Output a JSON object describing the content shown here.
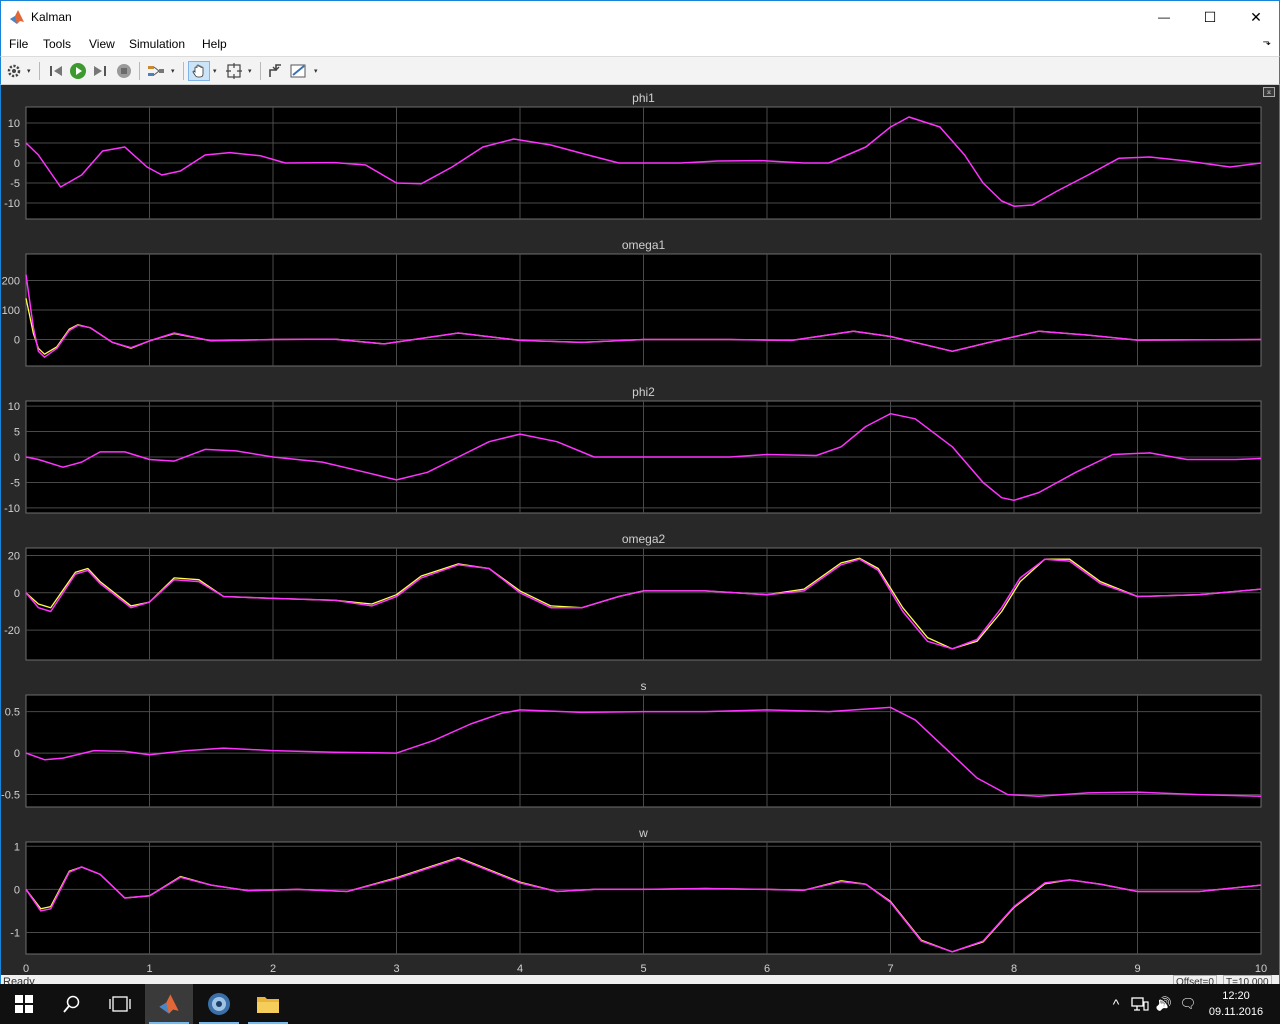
{
  "window": {
    "title": "Kalman",
    "minimize_glyph": "—",
    "maximize_glyph": "☐",
    "close_glyph": "✕"
  },
  "menu": {
    "items": [
      "File",
      "Tools",
      "View",
      "Simulation",
      "Help"
    ],
    "overflow_glyph": "⬎"
  },
  "toolbar": {
    "icons": [
      "settings-icon",
      "step-back-icon",
      "run-icon",
      "step-forward-icon",
      "stop-icon",
      "highlight-icon",
      "pan-icon",
      "zoom-fit-icon",
      "restore-icon",
      "measure-icon"
    ],
    "dropdown_glyph": "▾"
  },
  "scope": {
    "undock_glyph": "⌅",
    "colors": {
      "background": "#282828",
      "axes_bg": "#000000",
      "grid": "#4a4a4a",
      "frame": "#6e6e6e",
      "text": "#d0d0d0",
      "signal_a": "#ffff4d",
      "signal_b": "#ff33ff"
    },
    "x_ticks": [
      "0",
      "1",
      "2",
      "3",
      "4",
      "5",
      "6",
      "7",
      "8",
      "9",
      "10"
    ],
    "plots": [
      {
        "title": "phi1",
        "ylim": [
          -14,
          14
        ],
        "yticks": [
          {
            "v": 10,
            "l": "10"
          },
          {
            "v": 5,
            "l": "5"
          },
          {
            "v": 0,
            "l": "0"
          },
          {
            "v": -5,
            "l": "-5"
          },
          {
            "v": -10,
            "l": "-10"
          }
        ],
        "x": [
          0,
          0.1,
          0.28,
          0.45,
          0.62,
          0.8,
          0.98,
          1.1,
          1.25,
          1.45,
          1.65,
          1.9,
          2.1,
          2.5,
          2.75,
          3.0,
          3.2,
          3.45,
          3.7,
          3.95,
          4.25,
          4.55,
          4.8,
          5.0,
          5.3,
          5.6,
          5.95,
          6.3,
          6.5,
          6.8,
          7.0,
          7.15,
          7.4,
          7.6,
          7.75,
          7.9,
          8.0,
          8.15,
          8.35,
          8.6,
          8.85,
          9.1,
          9.4,
          9.75,
          10.0
        ],
        "y": [
          5,
          2,
          -6,
          -3,
          3,
          4,
          -1,
          -3,
          -2,
          2,
          2.6,
          1.8,
          0,
          0.1,
          -0.5,
          -5,
          -5.2,
          -1,
          4,
          6,
          4.5,
          2,
          0,
          0,
          0,
          0.5,
          0.6,
          0,
          0,
          4,
          9,
          11.5,
          9,
          2,
          -5,
          -9.5,
          -10.8,
          -10.5,
          -7,
          -3,
          1.2,
          1.5,
          0.5,
          -1,
          0
        ],
        "y2": null
      },
      {
        "title": "omega1",
        "ylim": [
          -90,
          290
        ],
        "yticks": [
          {
            "v": 200,
            "l": "200"
          },
          {
            "v": 100,
            "l": "100"
          },
          {
            "v": 0,
            "l": "0"
          }
        ],
        "x": [
          0,
          0.03,
          0.06,
          0.1,
          0.15,
          0.25,
          0.35,
          0.42,
          0.52,
          0.7,
          0.85,
          1.0,
          1.2,
          1.5,
          2.0,
          2.5,
          2.9,
          3.5,
          4.0,
          4.5,
          5.0,
          5.7,
          6.2,
          6.7,
          7.0,
          7.5,
          7.8,
          8.2,
          8.6,
          9.0,
          10.0
        ],
        "y": [
          220,
          130,
          40,
          -40,
          -60,
          -30,
          30,
          48,
          40,
          -10,
          -28,
          -5,
          22,
          -5,
          0,
          1,
          -15,
          22,
          -3,
          -10,
          0,
          0,
          -3,
          28,
          10,
          -40,
          -10,
          28,
          15,
          -2,
          0
        ],
        "y2": [
          140,
          80,
          20,
          -30,
          -50,
          -25,
          35,
          50,
          40,
          -10,
          -30,
          -5,
          20,
          -5,
          0,
          1,
          -15,
          22,
          -3,
          -10,
          0,
          0,
          -3,
          28,
          10,
          -40,
          -10,
          28,
          15,
          -2,
          0
        ]
      },
      {
        "title": "phi2",
        "ylim": [
          -11,
          11
        ],
        "yticks": [
          {
            "v": 10,
            "l": "10"
          },
          {
            "v": 5,
            "l": "5"
          },
          {
            "v": 0,
            "l": "0"
          },
          {
            "v": -5,
            "l": "-5"
          },
          {
            "v": -10,
            "l": "-10"
          }
        ],
        "x": [
          0,
          0.1,
          0.3,
          0.45,
          0.6,
          0.8,
          1.0,
          1.2,
          1.45,
          1.7,
          2.0,
          2.4,
          2.75,
          3.0,
          3.25,
          3.5,
          3.75,
          4.0,
          4.3,
          4.6,
          4.9,
          5.3,
          5.7,
          6.0,
          6.4,
          6.6,
          6.8,
          7.0,
          7.2,
          7.5,
          7.75,
          7.9,
          8.0,
          8.2,
          8.5,
          8.8,
          9.1,
          9.4,
          9.8,
          10.0
        ],
        "y": [
          0,
          -0.5,
          -2,
          -1,
          1,
          1,
          -0.5,
          -0.8,
          1.5,
          1.2,
          0,
          -1,
          -3,
          -4.5,
          -3,
          0,
          3,
          4.5,
          3,
          0,
          0,
          0,
          0,
          0.5,
          0.3,
          2,
          6,
          8.5,
          7.5,
          2,
          -5,
          -8,
          -8.5,
          -7,
          -3,
          0.5,
          0.8,
          -0.5,
          -0.5,
          -0.3
        ],
        "y2": null
      },
      {
        "title": "omega2",
        "ylim": [
          -36,
          24
        ],
        "yticks": [
          {
            "v": 20,
            "l": "20"
          },
          {
            "v": 0,
            "l": "0"
          },
          {
            "v": -20,
            "l": "-20"
          }
        ],
        "x": [
          0,
          0.1,
          0.2,
          0.4,
          0.5,
          0.6,
          0.85,
          1.0,
          1.2,
          1.4,
          1.6,
          2.0,
          2.5,
          2.8,
          3.0,
          3.2,
          3.5,
          3.75,
          4.0,
          4.25,
          4.5,
          4.8,
          5.0,
          5.5,
          6.0,
          6.3,
          6.6,
          6.75,
          6.9,
          7.1,
          7.3,
          7.5,
          7.7,
          7.9,
          8.05,
          8.25,
          8.45,
          8.7,
          9.0,
          9.5,
          10.0
        ],
        "y": [
          0,
          -8,
          -10,
          10,
          12,
          5,
          -8,
          -5,
          7,
          6,
          -2,
          -3,
          -4,
          -7,
          -2,
          8,
          15,
          13,
          0,
          -8,
          -8,
          -2,
          1,
          1,
          -1,
          1,
          15,
          18,
          12,
          -10,
          -26,
          -30,
          -25,
          -8,
          8,
          18,
          17,
          5,
          -2,
          -1,
          2
        ],
        "y2": [
          0,
          -6,
          -8,
          11,
          13,
          6,
          -7,
          -5,
          8,
          7,
          -2,
          -3,
          -4,
          -6,
          -1,
          9,
          15.5,
          13,
          1,
          -7,
          -8,
          -2,
          1,
          1,
          -1,
          2,
          16,
          18.5,
          13,
          -8,
          -24,
          -30,
          -26,
          -10,
          6,
          18,
          18,
          6,
          -2,
          -1,
          2
        ]
      },
      {
        "title": "s",
        "ylim": [
          -0.65,
          0.7
        ],
        "yticks": [
          {
            "v": 0.5,
            "l": "0.5"
          },
          {
            "v": 0,
            "l": "0"
          },
          {
            "v": -0.5,
            "l": "-0.5"
          }
        ],
        "x": [
          0,
          0.15,
          0.3,
          0.55,
          0.8,
          1.0,
          1.3,
          1.6,
          2.0,
          2.5,
          3.0,
          3.3,
          3.6,
          3.85,
          4.0,
          4.5,
          5.0,
          5.5,
          6.0,
          6.5,
          7.0,
          7.2,
          7.45,
          7.7,
          7.95,
          8.2,
          8.6,
          9.0,
          9.5,
          10.0
        ],
        "y": [
          0,
          -0.08,
          -0.06,
          0.03,
          0.02,
          -0.02,
          0.03,
          0.06,
          0.03,
          0.01,
          0,
          0.15,
          0.35,
          0.48,
          0.52,
          0.49,
          0.5,
          0.5,
          0.52,
          0.5,
          0.55,
          0.4,
          0.05,
          -0.3,
          -0.5,
          -0.52,
          -0.48,
          -0.47,
          -0.5,
          -0.52
        ],
        "y2": null
      },
      {
        "title": "w",
        "ylim": [
          -1.5,
          1.1
        ],
        "yticks": [
          {
            "v": 1,
            "l": "1"
          },
          {
            "v": 0,
            "l": "0"
          },
          {
            "v": -1,
            "l": "-1"
          }
        ],
        "x": [
          0,
          0.12,
          0.2,
          0.35,
          0.45,
          0.6,
          0.8,
          1.0,
          1.25,
          1.5,
          1.8,
          2.2,
          2.6,
          3.0,
          3.5,
          4.0,
          4.3,
          4.6,
          5.0,
          5.5,
          6.0,
          6.3,
          6.6,
          6.8,
          7.0,
          7.25,
          7.5,
          7.75,
          8.0,
          8.25,
          8.45,
          8.7,
          9.0,
          9.5,
          10.0
        ],
        "y": [
          0,
          -0.5,
          -0.45,
          0.4,
          0.52,
          0.35,
          -0.2,
          -0.15,
          0.28,
          0.1,
          -0.03,
          0,
          -0.05,
          0.25,
          0.72,
          0.15,
          -0.05,
          0,
          0,
          0.02,
          0,
          -0.02,
          0.18,
          0.12,
          -0.3,
          -1.2,
          -1.45,
          -1.2,
          -0.4,
          0.15,
          0.22,
          0.12,
          -0.05,
          -0.05,
          0.1
        ],
        "y2": [
          0,
          -0.45,
          -0.4,
          0.42,
          0.52,
          0.35,
          -0.2,
          -0.15,
          0.3,
          0.1,
          -0.03,
          0,
          -0.05,
          0.27,
          0.74,
          0.17,
          -0.05,
          0,
          0,
          0.02,
          0,
          -0.02,
          0.2,
          0.12,
          -0.28,
          -1.18,
          -1.45,
          -1.22,
          -0.42,
          0.13,
          0.22,
          0.12,
          -0.05,
          -0.05,
          0.1
        ]
      }
    ]
  },
  "status": {
    "text": "Ready",
    "offset": "Offset=0",
    "time": "T=10.000"
  },
  "taskbar": {
    "apps": [
      "windows-start-icon",
      "search-icon",
      "task-view-icon",
      "matlab-icon",
      "browser-icon",
      "file-explorer-icon"
    ],
    "tray_glyphs": {
      "chevron": "^",
      "volume": "🔊",
      "notification": "🗨"
    },
    "time": "12:20",
    "date": "09.11.2016"
  }
}
